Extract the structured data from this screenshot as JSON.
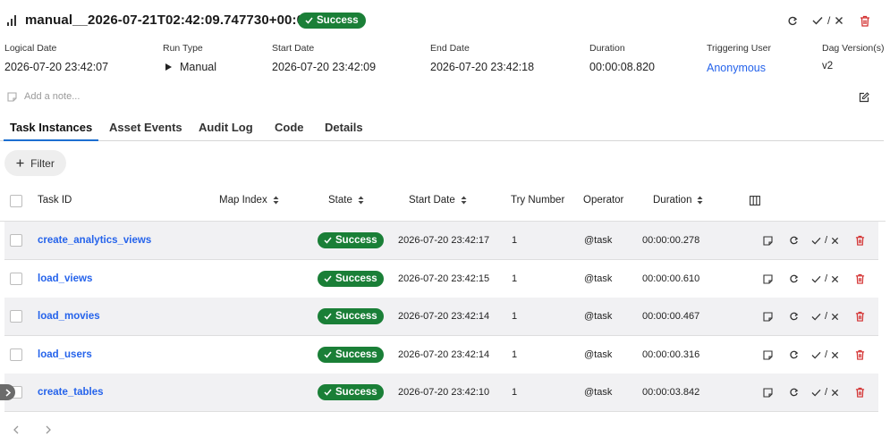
{
  "header": {
    "title": "manual__2026-07-21T02:42:09.747730+00:00",
    "state_badge": "Success",
    "actions": {
      "mark_separator": "/"
    }
  },
  "meta": [
    {
      "label": "Logical Date",
      "value": "2026-07-20 23:42:07"
    },
    {
      "label": "Run Type",
      "value": "Manual"
    },
    {
      "label": "Start Date",
      "value": "2026-07-20 23:42:09"
    },
    {
      "label": "End Date",
      "value": "2026-07-20 23:42:18"
    },
    {
      "label": "Duration",
      "value": "00:00:08.820"
    },
    {
      "label": "Triggering User",
      "value": "Anonymous"
    },
    {
      "label": "Dag Version(s)",
      "value": "v2"
    }
  ],
  "note": {
    "placeholder": "Add a note..."
  },
  "tabs": [
    {
      "label": "Task Instances",
      "active": true
    },
    {
      "label": "Asset Events"
    },
    {
      "label": "Audit Log"
    },
    {
      "label": "Code"
    },
    {
      "label": "Details"
    }
  ],
  "filter": {
    "label": "Filter"
  },
  "table": {
    "columns": {
      "task_id": "Task ID",
      "map_index": "Map Index",
      "state": "State",
      "start_date": "Start Date",
      "try_number": "Try Number",
      "operator": "Operator",
      "duration": "Duration"
    },
    "rows": [
      {
        "task_id": "create_analytics_views",
        "state": "Success",
        "start_date": "2026-07-20 23:42:17",
        "try_number": "1",
        "operator": "@task",
        "duration": "00:00:00.278"
      },
      {
        "task_id": "load_views",
        "state": "Success",
        "start_date": "2026-07-20 23:42:15",
        "try_number": "1",
        "operator": "@task",
        "duration": "00:00:00.610"
      },
      {
        "task_id": "load_movies",
        "state": "Success",
        "start_date": "2026-07-20 23:42:14",
        "try_number": "1",
        "operator": "@task",
        "duration": "00:00:00.467"
      },
      {
        "task_id": "load_users",
        "state": "Success",
        "start_date": "2026-07-20 23:42:14",
        "try_number": "1",
        "operator": "@task",
        "duration": "00:00:00.316"
      },
      {
        "task_id": "create_tables",
        "state": "Success",
        "start_date": "2026-07-20 23:42:10",
        "try_number": "1",
        "operator": "@task",
        "duration": "00:00:03.842"
      }
    ],
    "row_actions": {
      "mark_separator": "/"
    }
  },
  "colors": {
    "success": "#1a7f37",
    "link": "#2563eb",
    "delete": "#d32f2f",
    "accent_tab": "#1c6fd1"
  },
  "icons": [
    "bar-chart-icon",
    "check-icon",
    "refresh-icon",
    "close-icon",
    "trash-icon",
    "note-icon",
    "edit-icon",
    "plus-icon",
    "sort-icon",
    "columns-icon",
    "play-icon",
    "chevron-right-icon",
    "chevron-left-icon"
  ]
}
